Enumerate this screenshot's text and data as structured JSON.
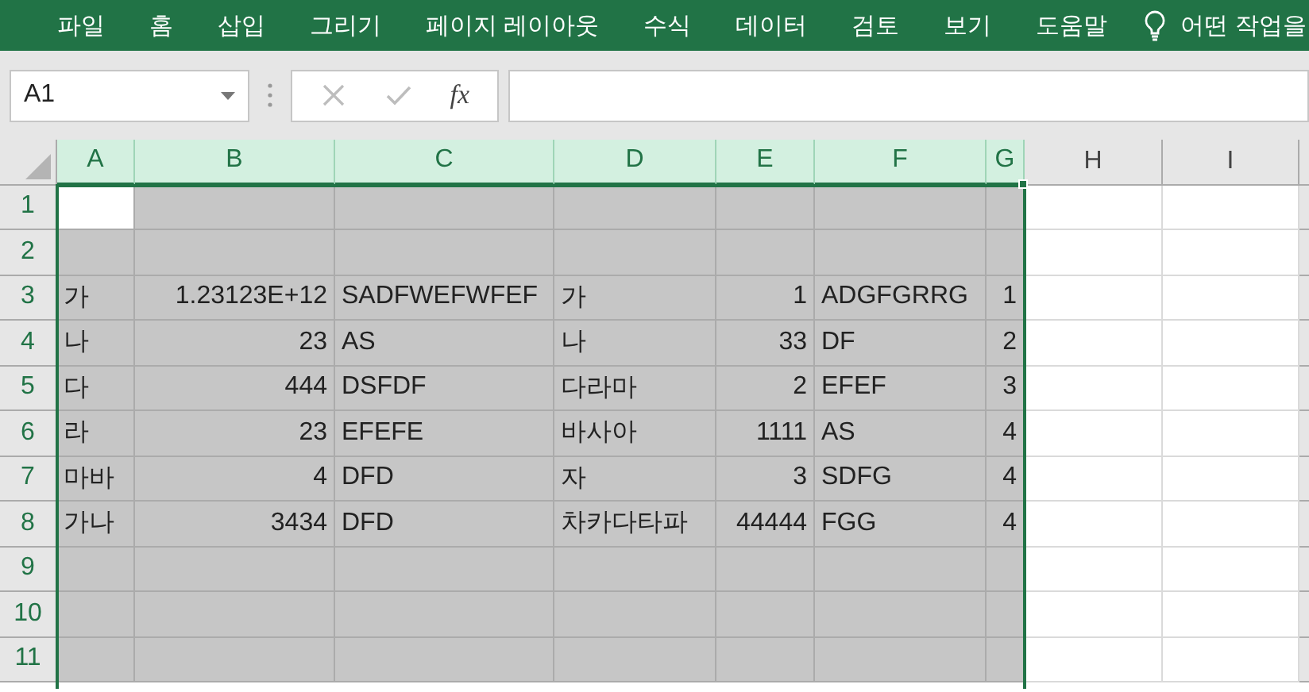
{
  "ribbon_tabs": [
    {
      "label": "파일"
    },
    {
      "label": "홈"
    },
    {
      "label": "삽입"
    },
    {
      "label": "그리기"
    },
    {
      "label": "페이지 레이아웃"
    },
    {
      "label": "수식"
    },
    {
      "label": "데이터"
    },
    {
      "label": "검토"
    },
    {
      "label": "보기"
    },
    {
      "label": "도움말"
    }
  ],
  "tell_me": {
    "placeholder": "어떤 작업을"
  },
  "name_box": {
    "value": "A1"
  },
  "formula_buttons": {
    "cancel_disabled": true,
    "enter_disabled": true,
    "function_label": "fx"
  },
  "columns": [
    {
      "label": "A",
      "selected": true
    },
    {
      "label": "B",
      "selected": true
    },
    {
      "label": "C",
      "selected": true
    },
    {
      "label": "D",
      "selected": true
    },
    {
      "label": "E",
      "selected": true
    },
    {
      "label": "F",
      "selected": true
    },
    {
      "label": "G",
      "selected": true
    },
    {
      "label": "H",
      "selected": false
    },
    {
      "label": "I",
      "selected": false
    }
  ],
  "rows": [
    {
      "header": "1",
      "selected": true,
      "cells": [
        {
          "active": true
        }
      ]
    },
    {
      "header": "2",
      "selected": true,
      "cells": []
    },
    {
      "header": "3",
      "selected": true,
      "cells": [
        {
          "value": "가",
          "kind": "text",
          "active": false
        },
        {
          "value": "1.23123E+12",
          "kind": "number",
          "active": false
        },
        {
          "value": "SADFWEFWFEF",
          "kind": "text",
          "active": false
        },
        {
          "value": "가",
          "kind": "text",
          "active": false
        },
        {
          "value": "1",
          "kind": "number",
          "active": false
        },
        {
          "value": "ADGFGRRG",
          "kind": "text",
          "active": false
        },
        {
          "value": "1",
          "kind": "number",
          "active": false
        }
      ]
    },
    {
      "header": "4",
      "selected": true,
      "cells": [
        {
          "value": "나",
          "kind": "text",
          "active": false
        },
        {
          "value": "23",
          "kind": "number",
          "active": false
        },
        {
          "value": "AS",
          "kind": "text",
          "active": false
        },
        {
          "value": "나",
          "kind": "text",
          "active": false
        },
        {
          "value": "33",
          "kind": "number",
          "active": false
        },
        {
          "value": "DF",
          "kind": "text",
          "active": false
        },
        {
          "value": "2",
          "kind": "number",
          "active": false
        }
      ]
    },
    {
      "header": "5",
      "selected": true,
      "cells": [
        {
          "value": "다",
          "kind": "text",
          "active": false
        },
        {
          "value": "444",
          "kind": "number",
          "active": false
        },
        {
          "value": "DSFDF",
          "kind": "text",
          "active": false
        },
        {
          "value": "다라마",
          "kind": "text",
          "active": false
        },
        {
          "value": "2",
          "kind": "number",
          "active": false
        },
        {
          "value": "EFEF",
          "kind": "text",
          "active": false
        },
        {
          "value": "3",
          "kind": "number",
          "active": false
        }
      ]
    },
    {
      "header": "6",
      "selected": true,
      "cells": [
        {
          "value": "라",
          "kind": "text",
          "active": false
        },
        {
          "value": "23",
          "kind": "number",
          "active": false
        },
        {
          "value": "EFEFE",
          "kind": "text",
          "active": false
        },
        {
          "value": "바사아",
          "kind": "text",
          "active": false
        },
        {
          "value": "1111",
          "kind": "number",
          "active": false
        },
        {
          "value": "AS",
          "kind": "text",
          "active": false
        },
        {
          "value": "4",
          "kind": "number",
          "active": false
        }
      ]
    },
    {
      "header": "7",
      "selected": true,
      "cells": [
        {
          "value": "마바",
          "kind": "text",
          "active": false
        },
        {
          "value": "4",
          "kind": "number",
          "active": false
        },
        {
          "value": "DFD",
          "kind": "text",
          "active": false
        },
        {
          "value": "자",
          "kind": "text",
          "active": false
        },
        {
          "value": "3",
          "kind": "number",
          "active": false
        },
        {
          "value": "SDFG",
          "kind": "text",
          "active": false
        },
        {
          "value": "4",
          "kind": "number",
          "active": false
        }
      ]
    },
    {
      "header": "8",
      "selected": true,
      "cells": [
        {
          "value": "가나",
          "kind": "text",
          "active": false
        },
        {
          "value": "3434",
          "kind": "number",
          "active": false
        },
        {
          "value": "DFD",
          "kind": "text",
          "active": false
        },
        {
          "value": "차카다타파",
          "kind": "text",
          "active": false
        },
        {
          "value": "44444",
          "kind": "number",
          "active": false
        },
        {
          "value": "FGG",
          "kind": "text",
          "active": false
        },
        {
          "value": "4",
          "kind": "number",
          "active": false
        }
      ]
    },
    {
      "header": "9",
      "selected": true,
      "cells": []
    },
    {
      "header": "10",
      "selected": true,
      "cells": []
    },
    {
      "header": "11",
      "selected": true,
      "cells": []
    }
  ]
}
